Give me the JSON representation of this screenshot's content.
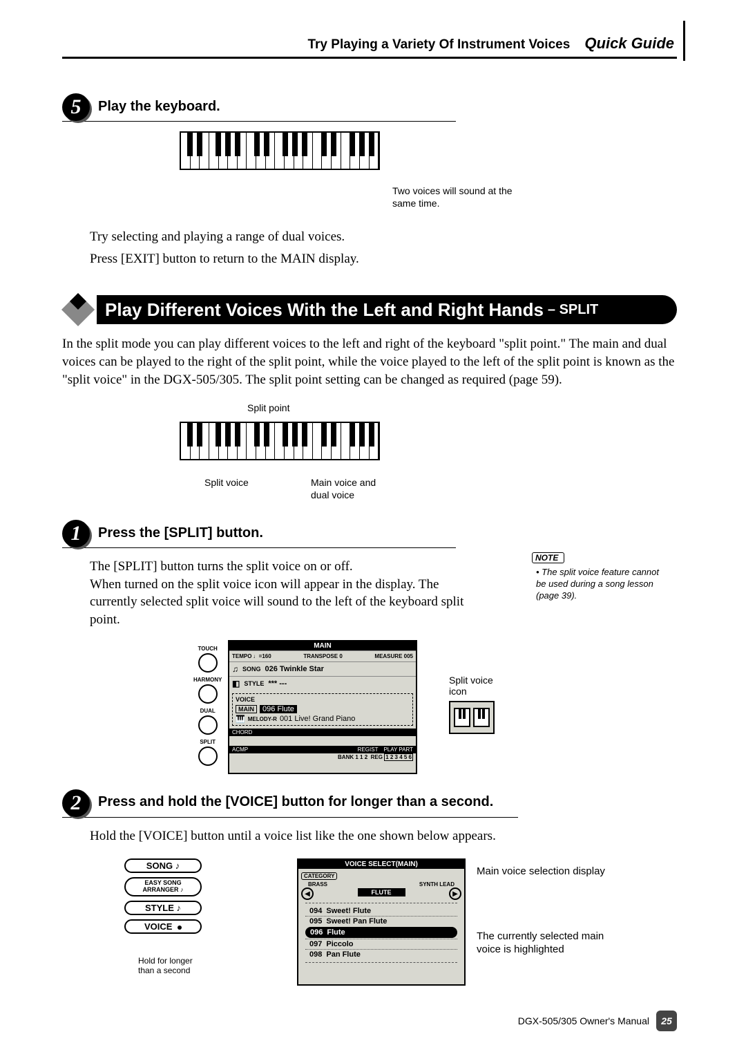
{
  "header": {
    "title_left": "Try Playing a Variety Of Instrument Voices",
    "title_right": "Quick Guide"
  },
  "step5": {
    "number": "5",
    "title": "Play the keyboard.",
    "caption_line1": "Two voices will sound at the",
    "caption_line2": "same time.",
    "body1": "Try selecting and playing a range of dual voices.",
    "body2": "Press [EXIT] button to return to the MAIN display."
  },
  "section": {
    "title_main": "Play Different Voices With the Left and Right Hands",
    "title_suffix": "– SPLIT",
    "intro": "In the split mode you can play different voices to the left and right of the keyboard \"split point.\" The main and dual voices can be played to the right of the split point, while the voice played to the left of the split point is known as the \"split voice\" in the DGX-505/305. The split point setting can be changed as required (page 59)."
  },
  "kb_labels": {
    "split_point": "Split point",
    "split_voice": "Split voice",
    "main_voice_line1": "Main voice and",
    "main_voice_line2": "dual voice"
  },
  "step1": {
    "number": "1",
    "title": "Press the [SPLIT] button.",
    "body1": "The [SPLIT] button turns the split voice on or off.",
    "body2": "When turned on the split voice icon will appear in the display. The currently selected split voice will sound to the left of the keyboard split point."
  },
  "note": {
    "label": "NOTE",
    "body": "• The split voice feature cannot be used during a song lesson (page 39)."
  },
  "knobs": {
    "touch": "TOUCH",
    "harmony": "HARMONY",
    "dual": "DUAL",
    "split": "SPLIT"
  },
  "lcd_main": {
    "title": "MAIN",
    "tempo": "TEMPO ♩=160",
    "transpose": "TRANSPOSE 0",
    "measure": "MEASURE 005",
    "song_lbl": "SONG",
    "song": "026 Twinkle Star",
    "style_lbl": "STYLE",
    "style": "*** ---",
    "voice_lbl": "VOICE",
    "main_lbl": "MAIN",
    "main_val": "096 Flute",
    "melodyr_lbl": "MELODY-R",
    "melodyr_val": "001 Live! Grand Piano",
    "chord_lbl": "CHORD",
    "acmp_lbl": "ACMP",
    "regist_lbl": "REGIST",
    "playpart_lbl": "PLAY PART",
    "bank_lbl": "BANK 1",
    "bank_nums": "1 2",
    "reg_lbl": "REG",
    "reg_nums": "1 2 3 4 5 6"
  },
  "split_callout": {
    "label_line1": "Split voice",
    "label_line2": "icon"
  },
  "step2": {
    "number": "2",
    "title": "Press and hold the [VOICE] button for longer than a second.",
    "body1": "Hold the [VOICE] button until a voice list like the one shown below appears."
  },
  "panel_buttons": {
    "song": "SONG",
    "easy_line1": "EASY SONG",
    "easy_line2": "ARRANGER",
    "style": "STYLE",
    "voice": "VOICE",
    "hold_line1": "Hold for longer",
    "hold_line2": "than a second"
  },
  "voice_lcd": {
    "title": "VOICE SELECT(MAIN)",
    "category_lbl": "CATEGORY",
    "brass": "BRASS",
    "synth_lead": "SYNTH LEAD",
    "flute": "FLUTE",
    "back": "◀",
    "fwd": "▶",
    "list": [
      {
        "num": "094",
        "name": "Sweet! Flute"
      },
      {
        "num": "095",
        "name": "Sweet! Pan Flute"
      },
      {
        "num": "096",
        "name": "Flute"
      },
      {
        "num": "097",
        "name": "Piccolo"
      },
      {
        "num": "098",
        "name": "Pan Flute"
      }
    ]
  },
  "right_callouts": {
    "top": "Main voice selection display",
    "bottom_line1": "The currently selected main",
    "bottom_line2": "voice is highlighted"
  },
  "footer": {
    "manual": "DGX-505/305  Owner's Manual",
    "page": "25"
  }
}
